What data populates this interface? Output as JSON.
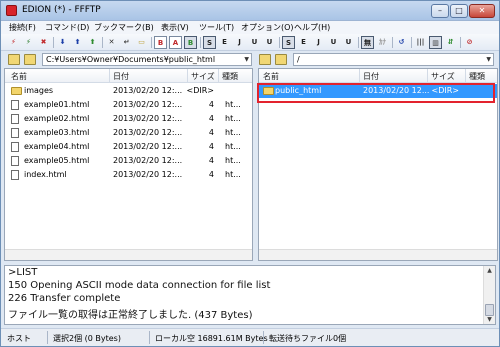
{
  "window": {
    "title": "EDION (*) - FFFTP"
  },
  "caption_buttons": {
    "minimize": "–",
    "maximize": "□",
    "close": "✕"
  },
  "menu": [
    "接続(F)",
    "コマンド(D)",
    "ブックマーク(B)",
    "表示(V)",
    "ツール(T)",
    "オプション(O)",
    "ヘルプ(H)"
  ],
  "toolbar": [
    {
      "name": "connect-icon",
      "glyph": "⚡",
      "color": "#c0282a",
      "style": ""
    },
    {
      "name": "quick-connect-icon",
      "glyph": "⚡",
      "color": "#2a7a2a",
      "style": ""
    },
    {
      "name": "disconnect-icon",
      "glyph": "✖",
      "color": "#c0282a",
      "style": ""
    },
    {
      "name": "download-icon",
      "glyph": "⬇",
      "color": "#1c3fa8",
      "style": ""
    },
    {
      "name": "upload-icon",
      "glyph": "⬆",
      "color": "#1c3fa8",
      "style": ""
    },
    {
      "name": "mirror-upload-icon",
      "glyph": "⬆",
      "color": "#2e8b2e",
      "style": ""
    },
    {
      "name": "delete-icon",
      "glyph": "✕",
      "color": "#333333",
      "style": ""
    },
    {
      "name": "rename-icon",
      "glyph": "↵",
      "color": "#333333",
      "style": ""
    },
    {
      "name": "new-folder-icon",
      "glyph": "▭",
      "color": "#b89a2a",
      "style": ""
    },
    {
      "name": "binary-mode-icon",
      "glyph": "B",
      "color": "#c0282a",
      "style": "boxed"
    },
    {
      "name": "ascii-mode-icon",
      "glyph": "A",
      "color": "#c0282a",
      "style": "boxed"
    },
    {
      "name": "auto-mode-icon",
      "glyph": "B",
      "color": "#2e8b2e",
      "style": "sel"
    },
    {
      "name": "kanji-sjis-icon",
      "glyph": "S",
      "color": "#222222",
      "style": "sel"
    },
    {
      "name": "kanji-euc-icon",
      "glyph": "E",
      "color": "#222222",
      "style": ""
    },
    {
      "name": "kanji-jis-icon",
      "glyph": "J",
      "color": "#222222",
      "style": ""
    },
    {
      "name": "kanji-utf8n-icon",
      "glyph": "U",
      "color": "#222222",
      "style": ""
    },
    {
      "name": "kanji-utf8-icon",
      "glyph": "U",
      "color": "#222222",
      "style": ""
    },
    {
      "name": "remote-sjis-icon",
      "glyph": "S",
      "color": "#222222",
      "style": "sel"
    },
    {
      "name": "remote-euc-icon",
      "glyph": "E",
      "color": "#222222",
      "style": ""
    },
    {
      "name": "remote-jis-icon",
      "glyph": "J",
      "color": "#222222",
      "style": ""
    },
    {
      "name": "remote-utf8n-icon",
      "glyph": "U",
      "color": "#222222",
      "style": ""
    },
    {
      "name": "remote-utf8-icon",
      "glyph": "U",
      "color": "#222222",
      "style": ""
    },
    {
      "name": "no-conversion-icon",
      "glyph": "無",
      "color": "#222222",
      "style": "sel"
    },
    {
      "name": "kana-conversion-icon",
      "glyph": "ｶﾅ",
      "color": "#999999",
      "style": ""
    },
    {
      "name": "refresh-icon",
      "glyph": "↺",
      "color": "#1c3fa8",
      "style": ""
    },
    {
      "name": "list-view-icon",
      "glyph": "|||",
      "color": "#333333",
      "style": ""
    },
    {
      "name": "detail-view-icon",
      "glyph": "▥",
      "color": "#333333",
      "style": "sel"
    },
    {
      "name": "sync-folder-icon",
      "glyph": "⇵",
      "color": "#2e8b2e",
      "style": ""
    },
    {
      "name": "stop-icon",
      "glyph": "⊘",
      "color": "#c0282a",
      "style": ""
    }
  ],
  "local": {
    "path": "C:¥Users¥Owner¥Documents¥public_html",
    "columns": {
      "name": "名前",
      "date": "日付",
      "size": "サイズ",
      "type": "種類"
    },
    "files": [
      {
        "name": "images",
        "date": "2013/02/20 12:...",
        "size": "<DIR>",
        "type": "",
        "kind": "dir"
      },
      {
        "name": "example01.html",
        "date": "2013/02/20 12:...",
        "size": "4",
        "type": "ht...",
        "kind": "file"
      },
      {
        "name": "example02.html",
        "date": "2013/02/20 12:...",
        "size": "4",
        "type": "ht...",
        "kind": "file"
      },
      {
        "name": "example03.html",
        "date": "2013/02/20 12:...",
        "size": "4",
        "type": "ht...",
        "kind": "file"
      },
      {
        "name": "example04.html",
        "date": "2013/02/20 12:...",
        "size": "4",
        "type": "ht...",
        "kind": "file"
      },
      {
        "name": "example05.html",
        "date": "2013/02/20 12:...",
        "size": "4",
        "type": "ht...",
        "kind": "file"
      },
      {
        "name": "index.html",
        "date": "2013/02/20 12:...",
        "size": "4",
        "type": "ht...",
        "kind": "file"
      }
    ]
  },
  "remote": {
    "path": "/",
    "columns": {
      "name": "名前",
      "date": "日付",
      "size": "サイズ",
      "type": "種類"
    },
    "files": [
      {
        "name": "public_html",
        "date": "2013/02/20 12...",
        "size": "<DIR>",
        "type": "",
        "kind": "dir",
        "selected": true
      }
    ]
  },
  "log": [
    ">LIST",
    "150 Opening ASCII mode data connection for file list",
    "226 Transfer complete",
    "ファイル一覧の取得は正常終了しました. (437 Bytes)"
  ],
  "status": {
    "host": "ホスト",
    "selection": "選択2個 (0 Bytes)",
    "local_free": "ローカル空 16891.61M Bytes",
    "queue": "転送待ちファイル0個"
  },
  "colors": {
    "selection": "#3399ff",
    "highlight_border": "#e3232e"
  }
}
